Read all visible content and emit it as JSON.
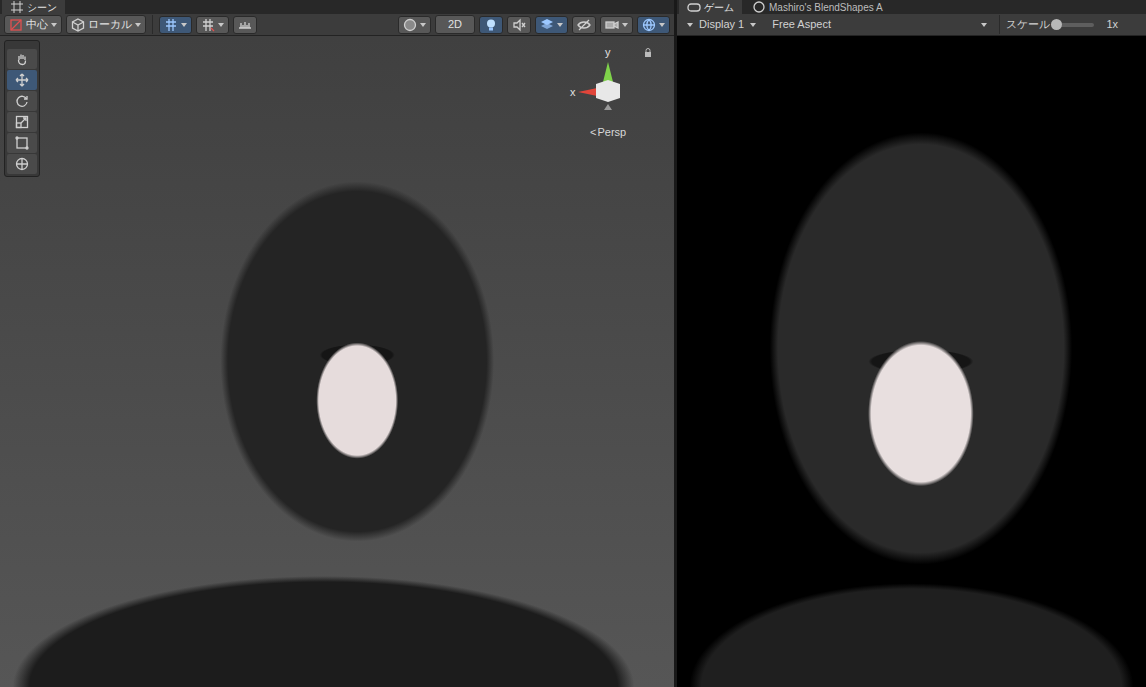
{
  "scene": {
    "tab": {
      "label": "シーン",
      "selected": true
    },
    "toolbar": {
      "pivot": "中心",
      "space": "ローカル",
      "snap": [
        {
          "kind": "grid",
          "on": true
        },
        {
          "kind": "increment",
          "on": false
        },
        {
          "kind": "ruler",
          "on": false
        }
      ],
      "view": [
        {
          "kind": "shading",
          "on": false,
          "dropdown": true
        },
        {
          "kind": "text",
          "label": "2D",
          "on": false,
          "dropdown": false
        },
        {
          "kind": "light",
          "on": true,
          "dropdown": false
        },
        {
          "kind": "audio",
          "on": false,
          "dropdown": false
        },
        {
          "kind": "effects",
          "on": true,
          "dropdown": true
        },
        {
          "kind": "hidden",
          "on": false,
          "dropdown": false
        },
        {
          "kind": "camera",
          "on": false,
          "dropdown": true
        },
        {
          "kind": "gizmos",
          "on": true,
          "dropdown": true
        }
      ]
    },
    "tools": [
      {
        "kind": "hand",
        "selected": false
      },
      {
        "kind": "move",
        "selected": true
      },
      {
        "kind": "rotate",
        "selected": false
      },
      {
        "kind": "scale",
        "selected": false
      },
      {
        "kind": "rect",
        "selected": false
      },
      {
        "kind": "transform",
        "selected": false
      }
    ],
    "gizmo": {
      "y": "y",
      "x": "x",
      "projection_icon": "<",
      "projection": "Persp"
    }
  },
  "game": {
    "tabs": [
      {
        "label": "ゲーム",
        "selected": true
      },
      {
        "label": "Mashiro's BlendShapes A",
        "selected": false
      }
    ],
    "display": "Display 1",
    "aspect": "Free Aspect",
    "scale_label": "スケール",
    "scale": {
      "level": 0.05,
      "reading": "1x"
    }
  }
}
